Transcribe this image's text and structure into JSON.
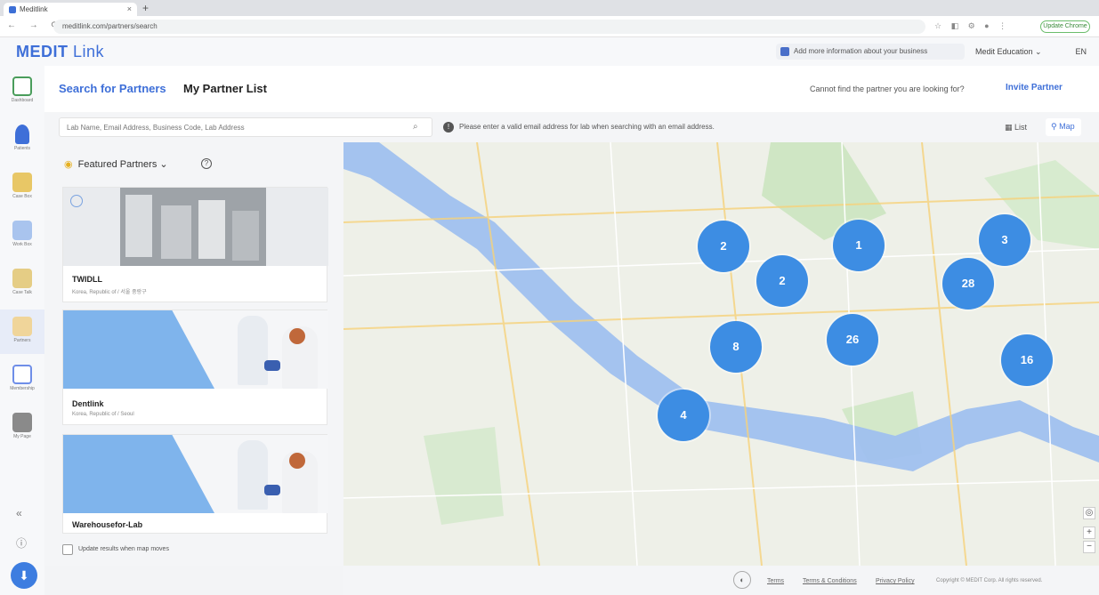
{
  "browser": {
    "tab_title": "Meditlink",
    "url": "meditlink.com/partners/search",
    "profile_label": "Update Chrome"
  },
  "header": {
    "logo_main": "MEDIT",
    "logo_sub": " Link",
    "info_banner": "Add more information about your business",
    "organization": "Medit Education",
    "language": "EN"
  },
  "sidebar": {
    "items": [
      {
        "label": "Dashboard",
        "color": "#4a9d5b"
      },
      {
        "label": "Patients",
        "color": "#3e6fd8"
      },
      {
        "label": "Case Box",
        "color": "#e2b84a"
      },
      {
        "label": "Work Box",
        "color": "#7aa3e0"
      },
      {
        "label": "Case Talk",
        "color": "#e0c06b"
      },
      {
        "label": "Partners",
        "color": "#e6c47a"
      },
      {
        "label": "Membership",
        "color": "#6f8ee8"
      },
      {
        "label": "My Page",
        "color": "#7b7b7b"
      }
    ]
  },
  "page": {
    "tab_search": "Search for Partners",
    "tab_mylist": "My Partner List",
    "cant_find": "Cannot find the partner you are looking for?",
    "invite": "Invite Partner"
  },
  "search": {
    "placeholder": "Lab Name, Email Address, Business Code, Lab Address",
    "warning": "Please enter a valid email address for lab when searching with an email address.",
    "view_list": "List",
    "view_map": "Map"
  },
  "featured": {
    "label": "Featured Partners",
    "cards": [
      {
        "title": "TWIDLL",
        "subtitle": "Korea, Republic of / 서울 중랑구"
      },
      {
        "title": "Dentlink",
        "subtitle": "Korea, Republic of / Seoul"
      },
      {
        "title": "Warehousefor-Lab",
        "subtitle": ""
      }
    ],
    "update_label": "Update results when map moves"
  },
  "map": {
    "clusters": [
      "2",
      "2",
      "1",
      "3",
      "28",
      "8",
      "26",
      "16",
      "4"
    ],
    "zoom_in": "+",
    "zoom_out": "−"
  },
  "footer": {
    "links": [
      "Terms",
      "Terms & Conditions",
      "Privacy Policy"
    ],
    "copyright": "Copyright © MEDIT Corp. All rights reserved."
  }
}
